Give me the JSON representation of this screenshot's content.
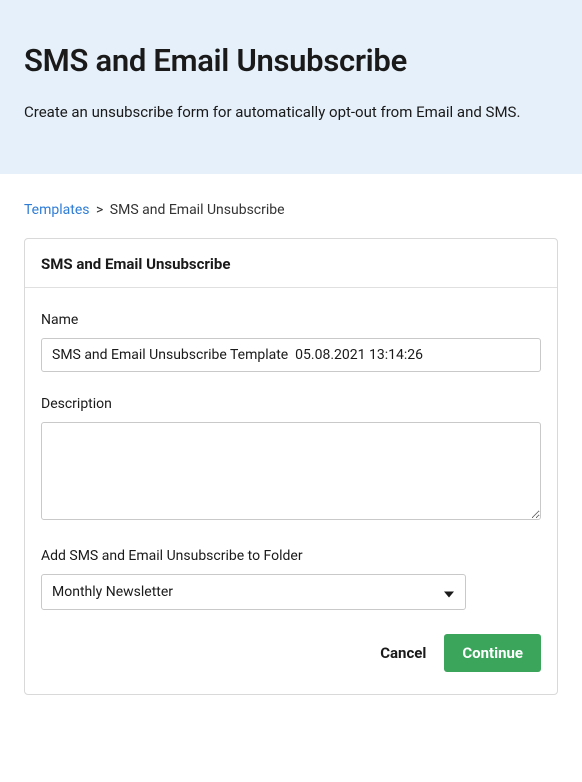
{
  "header": {
    "title": "SMS and Email Unsubscribe",
    "subtitle": "Create an unsubscribe form for automatically opt-out from Email and SMS."
  },
  "breadcrumb": {
    "root": "Templates",
    "separator": ">",
    "current": "SMS and Email Unsubscribe"
  },
  "card": {
    "title": "SMS and Email Unsubscribe"
  },
  "form": {
    "name_label": "Name",
    "name_value": "SMS and Email Unsubscribe Template  05.08.2021 13:14:26",
    "description_label": "Description",
    "description_value": "",
    "folder_label": "Add SMS and Email Unsubscribe to Folder",
    "folder_selected": "Monthly Newsletter"
  },
  "buttons": {
    "cancel": "Cancel",
    "continue": "Continue"
  }
}
